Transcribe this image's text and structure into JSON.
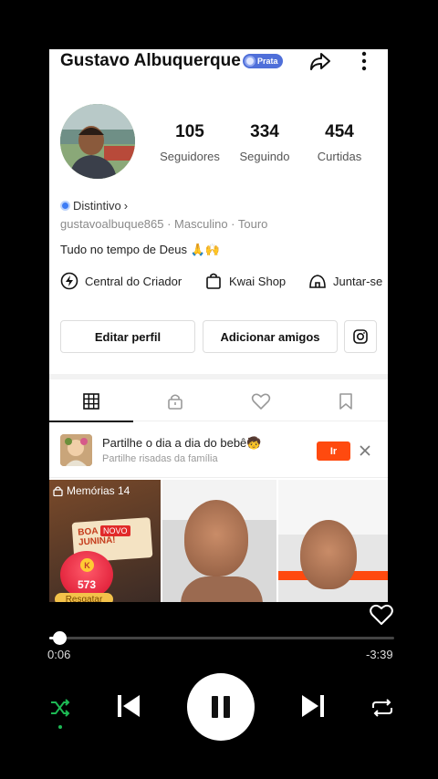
{
  "profile": {
    "username": "Gustavo Albuquerque",
    "tier_badge": "Prata",
    "stats": [
      {
        "value": "105",
        "label": "Seguidores"
      },
      {
        "value": "334",
        "label": "Seguindo"
      },
      {
        "value": "454",
        "label": "Curtidas"
      }
    ],
    "distintivo": "Distintivo",
    "meta": "gustavoalbuque865 · Masculino · Touro",
    "bio": "Tudo no tempo de Deus 🙏🙌",
    "shortcuts": [
      "Central do Criador",
      "Kwai Shop",
      "Juntar-se"
    ],
    "edit_button": "Editar perfil",
    "add_friends_button": "Adicionar amigos"
  },
  "promo": {
    "title": "Partilhe o dia a dia do bebê🧒",
    "subtitle": "Partilhe risadas da família",
    "button": "Ir"
  },
  "grid": {
    "memories_label": "Memórias 14",
    "festa_text": "BOA FESTA JUNINA!",
    "novo_label": "NOVO",
    "coin_value": "573",
    "coin_letter": "K",
    "resgatar_label": "Resgatar"
  },
  "player": {
    "elapsed": "0:06",
    "remaining": "-3:39",
    "progress": 0.03
  }
}
